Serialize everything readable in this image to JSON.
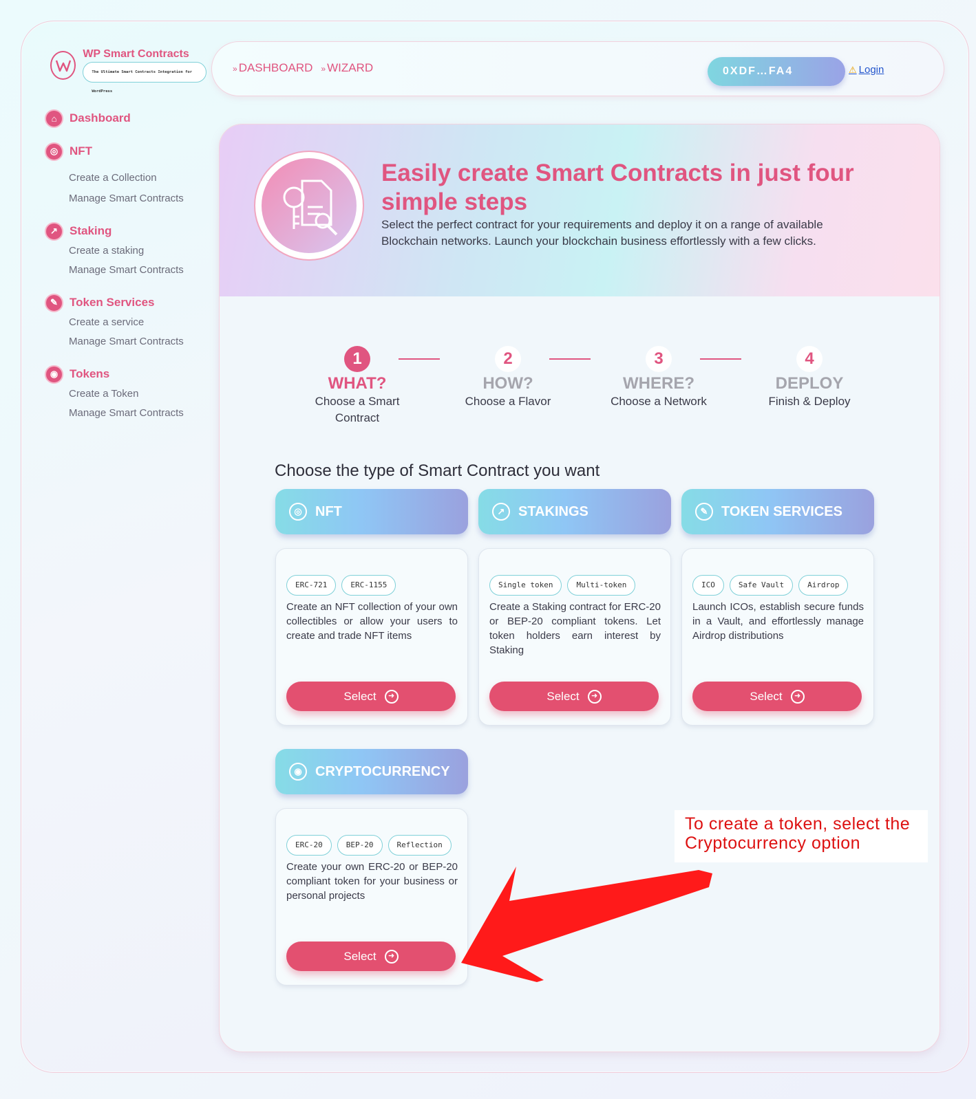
{
  "brand": {
    "name": "WP Smart Contracts",
    "tagline": "The Ultimate Smart Contracts Integration for WordPress"
  },
  "sidebar": {
    "dashboard": "Dashboard",
    "groups": [
      {
        "label": "NFT",
        "icon": "nft-icon",
        "items": [
          "Create a Collection",
          "Manage Smart Contracts"
        ]
      },
      {
        "label": "Staking",
        "icon": "chart-icon",
        "items": [
          "Create a staking",
          "Manage Smart Contracts"
        ]
      },
      {
        "label": "Token Services",
        "icon": "wrench-icon",
        "items": [
          "Create a service",
          "Manage Smart Contracts"
        ]
      },
      {
        "label": "Tokens",
        "icon": "coin-icon",
        "items": [
          "Create a Token",
          "Manage Smart Contracts"
        ]
      }
    ]
  },
  "topbar": {
    "crumbs": [
      "DASHBOARD",
      "WIZARD"
    ],
    "wallet": "0XDF…FA4",
    "login": "Login"
  },
  "hero": {
    "title": "Easily create Smart Contracts in just four simple steps",
    "description": "Select the perfect contract for your requirements and deploy it on a range of available Blockchain networks. Launch your blockchain business effortlessly with a few clicks."
  },
  "steps": [
    {
      "num": "1",
      "label": "WHAT?",
      "sub": "Choose a Smart Contract"
    },
    {
      "num": "2",
      "label": "HOW?",
      "sub": "Choose a Flavor"
    },
    {
      "num": "3",
      "label": "WHERE?",
      "sub": "Choose a Network"
    },
    {
      "num": "4",
      "label": "DEPLOY",
      "sub": "Finish & Deploy"
    }
  ],
  "choose_title": "Choose the type of Smart Contract you want",
  "categories": [
    {
      "title": "NFT",
      "tags": [
        "ERC-721",
        "ERC-1155"
      ],
      "desc": "Create an NFT collection of your own collectibles or allow your users to create and trade NFT items",
      "button": "Select"
    },
    {
      "title": "STAKINGS",
      "tags": [
        "Single token",
        "Multi-token"
      ],
      "desc": "Create a Staking contract for ERC-20 or BEP-20 compliant tokens. Let token holders earn interest by Staking",
      "button": "Select"
    },
    {
      "title": "TOKEN SERVICES",
      "tags": [
        "ICO",
        "Safe Vault",
        "Airdrop"
      ],
      "desc": "Launch ICOs, establish secure funds in a Vault, and effortlessly manage Airdrop distributions",
      "button": "Select"
    },
    {
      "title": "CRYPTOCURRENCY",
      "tags": [
        "ERC-20",
        "BEP-20",
        "Reflection"
      ],
      "desc": "Create your own ERC-20 or BEP-20 compliant token for your business or personal projects",
      "button": "Select"
    }
  ],
  "annotation": "To create a token, select the Cryptocurrency option"
}
